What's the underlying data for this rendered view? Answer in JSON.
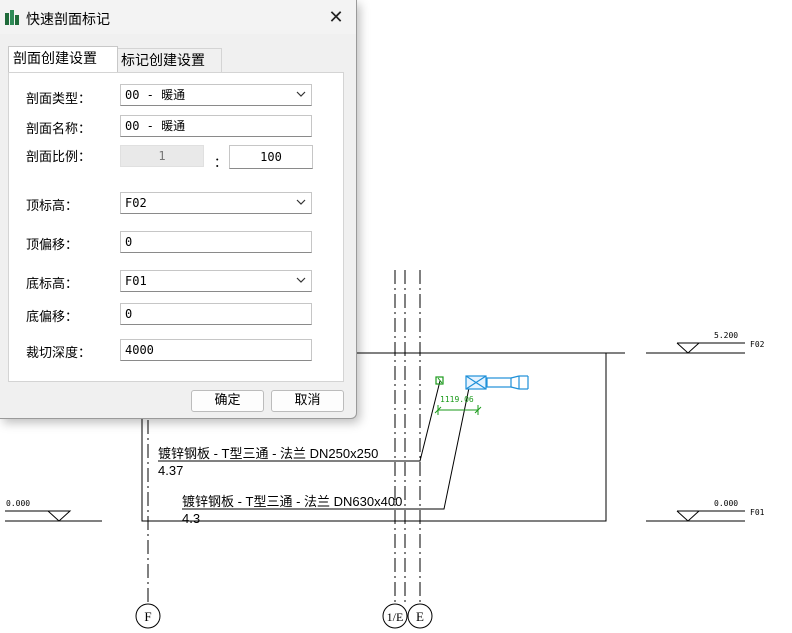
{
  "dialog": {
    "title": "快速剖面标记",
    "close_glyph": "✕",
    "tabs": [
      {
        "label": "剖面创建设置",
        "active": true
      },
      {
        "label": "标记创建设置",
        "active": false
      }
    ],
    "fields": {
      "section_type": {
        "label": "剖面类型：",
        "value": "00 - 暖通"
      },
      "section_name": {
        "label": "剖面名称：",
        "value": "00 - 暖通"
      },
      "section_scale": {
        "label": "剖面比例：",
        "value_a": "1",
        "separator": "：",
        "value_b": "100"
      },
      "top_level": {
        "label": "顶标高：",
        "value": "F02"
      },
      "top_offset": {
        "label": "顶偏移：",
        "value": "0"
      },
      "bottom_level": {
        "label": "底标高：",
        "value": "F01"
      },
      "bottom_offset": {
        "label": "底偏移：",
        "value": "0"
      },
      "crop_depth": {
        "label": "裁切深度：",
        "value": "4000"
      }
    },
    "buttons": {
      "ok": "确定",
      "cancel": "取消"
    }
  },
  "drawing": {
    "level_top": {
      "value": "5.200",
      "name": "F02"
    },
    "level_bottom_left": {
      "value": "0.000"
    },
    "level_bottom_right": {
      "value": "0.000",
      "name": "F01"
    },
    "dimension": "1119.06",
    "tags": [
      {
        "text": "镀锌钢板 - T型三通 - 法兰 DN250x250",
        "value": "4.37"
      },
      {
        "text": "镀锌钢板 - T型三通 - 法兰 DN630x400",
        "value": "4.3"
      }
    ],
    "grid_labels": [
      "F",
      "1/E",
      "E"
    ],
    "colors": {
      "annotation_green": "#1a9a1a",
      "section_blue": "#1e90d8",
      "line": "#000000"
    }
  }
}
